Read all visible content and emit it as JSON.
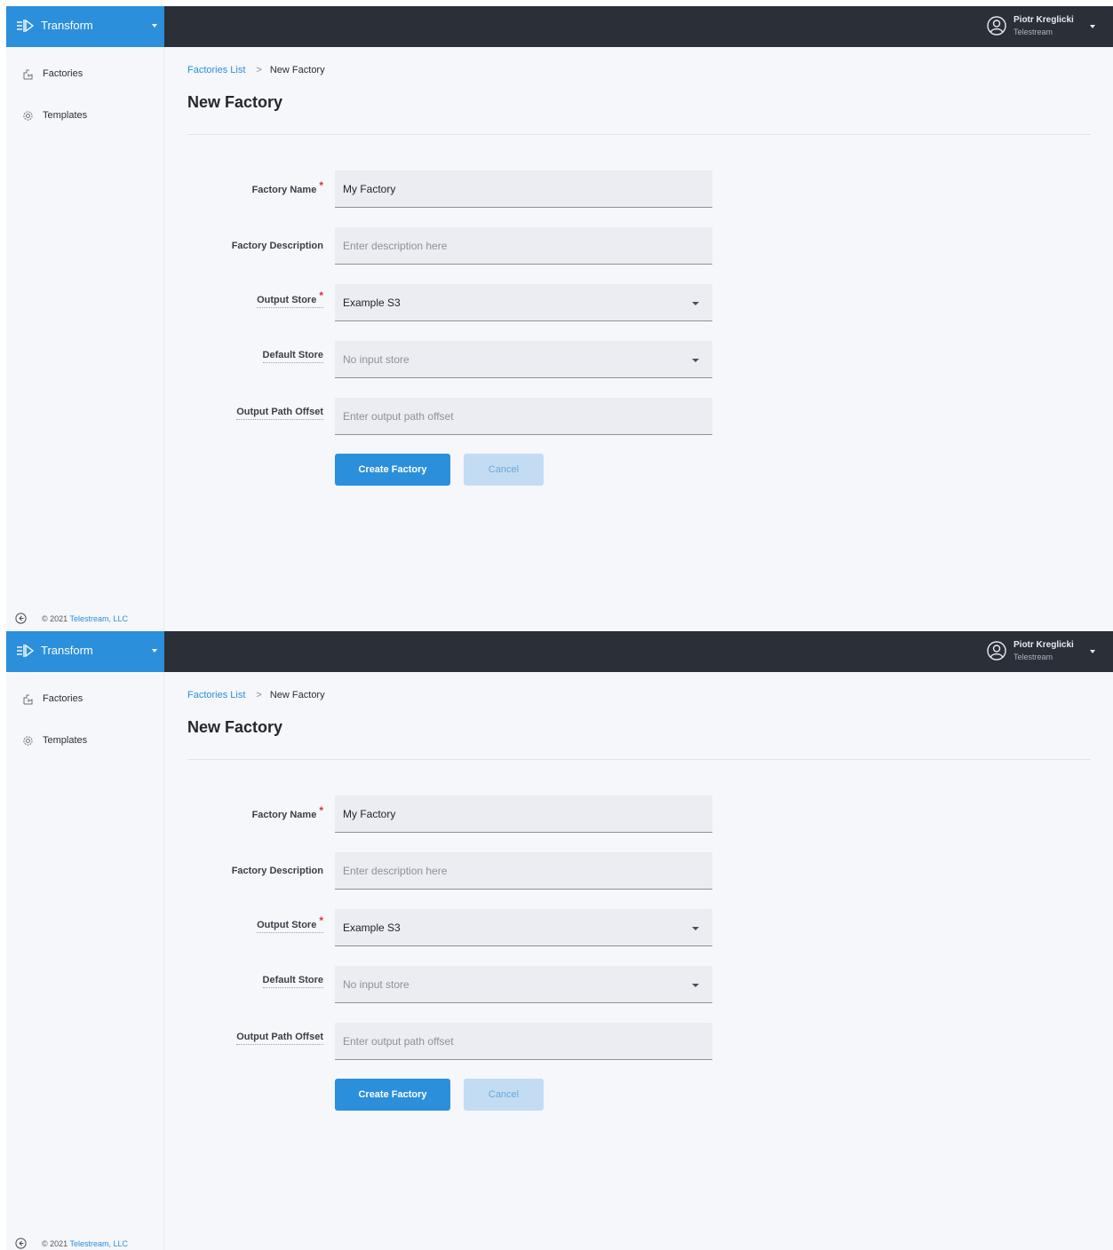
{
  "app": {
    "name": "Transform",
    "brand_color": "#2b8fdb",
    "topbar_color": "#2a2f38",
    "logo_icon": "transform-logo-icon",
    "caret_icon": "chevron-down-icon"
  },
  "user": {
    "name": "Piotr Kreglicki",
    "org": "Telestream",
    "icon": "user-avatar-icon"
  },
  "sidebar": {
    "items": [
      {
        "label": "Factories",
        "icon": "factory-icon"
      },
      {
        "label": "Templates",
        "icon": "gear-icon"
      }
    ],
    "footer": {
      "copyright": "© 2021",
      "company": "Telestream, LLC",
      "collapse_icon": "collapse-arrow-icon"
    }
  },
  "breadcrumb": {
    "parent": "Factories List",
    "separator": ">",
    "current": "New Factory"
  },
  "page": {
    "title": "New Factory"
  },
  "form": {
    "required_mark": "*",
    "fields": [
      {
        "label": "Factory Name",
        "required": true,
        "value": "My Factory",
        "placeholder": "",
        "type": "text"
      },
      {
        "label": "Factory Description",
        "required": false,
        "value": "",
        "placeholder": "Enter description here",
        "type": "text"
      },
      {
        "label": "Output Store",
        "required": true,
        "value": "Example S3",
        "placeholder": "",
        "type": "select"
      },
      {
        "label": "Default Store",
        "required": false,
        "value": "",
        "placeholder": "No input store",
        "type": "select"
      },
      {
        "label": "Output Path Offset",
        "required": false,
        "value": "",
        "placeholder": "Enter output path offset",
        "type": "text"
      }
    ],
    "submit_label": "Create Factory",
    "cancel_label": "Cancel"
  }
}
